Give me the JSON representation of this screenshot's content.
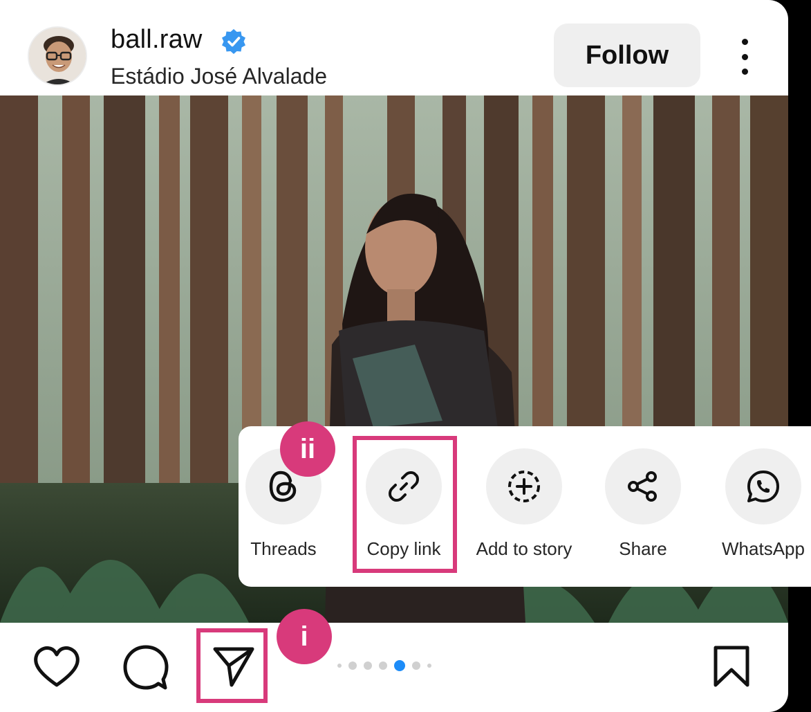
{
  "post": {
    "username": "ball.raw",
    "location": "Estádio José Alvalade",
    "follow_label": "Follow"
  },
  "share_sheet": {
    "items": [
      {
        "label": "Threads",
        "icon": "threads-icon"
      },
      {
        "label": "Copy link",
        "icon": "link-icon"
      },
      {
        "label": "Add to story",
        "icon": "add-story-icon"
      },
      {
        "label": "Share",
        "icon": "share-icon"
      },
      {
        "label": "WhatsApp",
        "icon": "whatsapp-icon"
      }
    ]
  },
  "annotations": {
    "step_1": "i",
    "step_2": "ii",
    "color": "#d83a7b"
  },
  "carousel": {
    "count": 7,
    "active_index": 4,
    "active_color": "#1d8cf8"
  },
  "verified_color": "#3897f0"
}
